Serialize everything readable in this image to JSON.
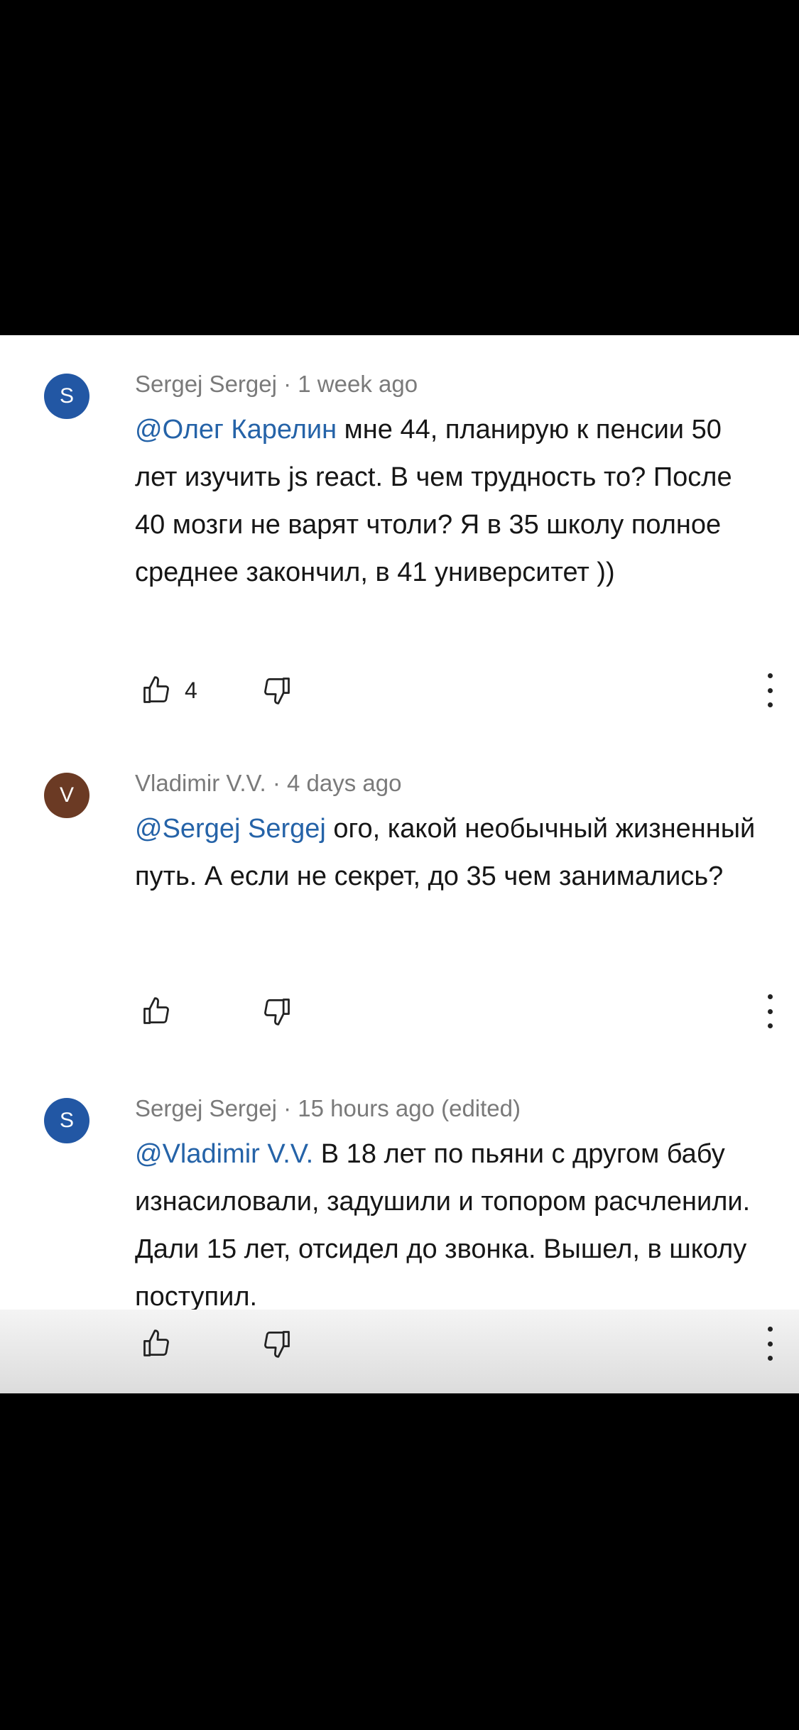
{
  "colors": {
    "avatar_s": "#2257a4",
    "avatar_v": "#6b3a24",
    "mention": "#2563a8"
  },
  "comments": [
    {
      "avatar_letter": "S",
      "author": "Sergej Sergej",
      "meta_sep": " · ",
      "time": "1 week ago",
      "mention": "@Олег Карелин",
      "text": " мне 44, планирую к пенсии 50 лет изучить js react. В чем трудность то? После 40 мозги не варят чтоли? Я в 35 школу полное среднее закончил, в 41 университет ))",
      "likes": "4"
    },
    {
      "avatar_letter": "V",
      "author": "Vladimir V.V.",
      "meta_sep": " · ",
      "time": "4 days ago",
      "mention": "@Sergej Sergej",
      "text": " ого, какой необычный жизненный путь. А если не секрет, до 35 чем занимались?"
    },
    {
      "avatar_letter": "S",
      "author": "Sergej Sergej",
      "meta_sep": " · ",
      "time": "15 hours ago (edited)",
      "mention": "@Vladimir V.V.",
      "text": " В 18 лет по пьяни с другом бабу изнасиловали, задушили и топором расчленили. Дали 15 лет, отсидел до звонка. Вышел, в школу поступил."
    }
  ],
  "icons": {
    "like": "thumbs-up-icon",
    "dislike": "thumbs-down-icon",
    "more": "more-vert-icon"
  }
}
